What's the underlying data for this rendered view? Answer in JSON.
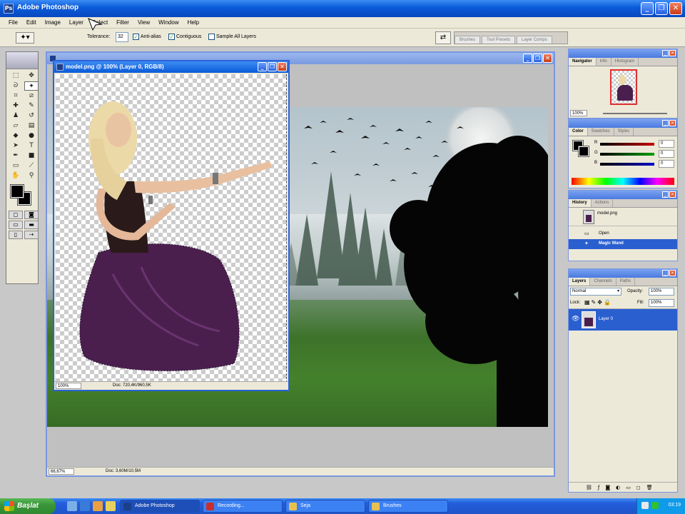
{
  "app": {
    "title": "Adobe Photoshop",
    "icon_label": "Ps"
  },
  "menu": [
    "File",
    "Edit",
    "Image",
    "Layer",
    "Select",
    "Filter",
    "View",
    "Window",
    "Help"
  ],
  "options": {
    "tolerance_label": "Tolerance:",
    "tolerance_value": "32",
    "antialias_label": "Anti-alias",
    "antialias_checked": true,
    "contiguous_label": "Contiguous",
    "contiguous_checked": true,
    "sample_all_label": "Sample All Layers",
    "sample_all_checked": false
  },
  "palette_well_tabs": [
    "Brushes",
    "Tool Presets",
    "Layer Comps"
  ],
  "bg_document": {
    "zoom": "66,67%",
    "doc_info": "Doc: 3,60M/10,5M"
  },
  "model_document": {
    "title": "model.png @ 100% (Layer 0, RGB/8)",
    "zoom": "100%",
    "doc_info": "Doc: 720,4K/960,5K"
  },
  "navigator": {
    "tabs": [
      "Navigator",
      "Info",
      "Histogram"
    ],
    "zoom": "100%"
  },
  "color_palette": {
    "tabs": [
      "Color",
      "Swatches",
      "Styles"
    ],
    "channels": [
      {
        "label": "R",
        "value": "0",
        "color": "#c80000"
      },
      {
        "label": "G",
        "value": "0",
        "color": "#00a000"
      },
      {
        "label": "B",
        "value": "0",
        "color": "#0000c8"
      }
    ]
  },
  "history": {
    "tabs": [
      "History",
      "Actions"
    ],
    "snapshot": "model.png",
    "items": [
      "Open",
      "Magic Wand"
    ],
    "active_index": 1
  },
  "layers": {
    "tabs": [
      "Layers",
      "Channels",
      "Paths"
    ],
    "blend_mode": "Normal",
    "opacity_label": "Opacity:",
    "opacity_value": "100%",
    "lock_label": "Lock:",
    "fill_label": "Fill:",
    "fill_value": "100%",
    "items": [
      {
        "name": "Layer 0",
        "selected": true,
        "visible": true
      }
    ]
  },
  "taskbar": {
    "start_label": "Başlat",
    "buttons": [
      "Adobe Photoshop",
      "Recording...",
      "Seja",
      "Brushes"
    ],
    "active_index": 0,
    "clock": "03:19"
  },
  "colors": {
    "xp_blue": "#0a5ad8",
    "selection_blue": "#2a5fd0",
    "dress_purple": "#4a1f4e"
  }
}
